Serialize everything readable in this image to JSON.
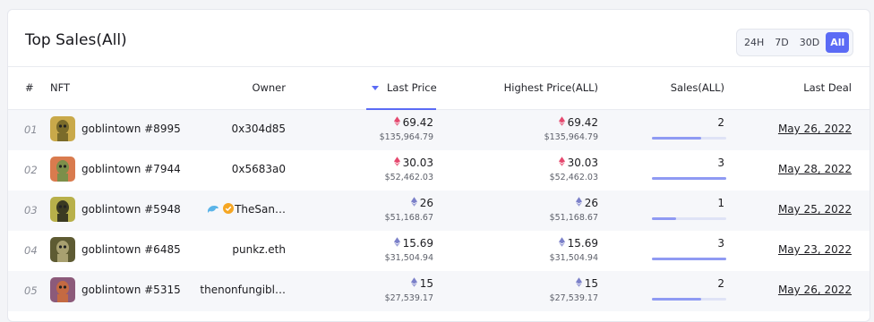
{
  "title": "Top Sales(All)",
  "time_ranges": [
    "24H",
    "7D",
    "30D",
    "All"
  ],
  "active_range": "All",
  "columns": {
    "rank": "#",
    "nft": "NFT",
    "owner": "Owner",
    "last_price": "Last Price",
    "highest_price": "Highest Price(ALL)",
    "sales": "Sales(ALL)",
    "last_deal": "Last Deal"
  },
  "sort_column": "Last Price",
  "colors": {
    "accent": "#5b6bf5",
    "eth_red": "#e5486e",
    "eth_purple": "#7b80c9"
  },
  "rows": [
    {
      "rank": "01",
      "name": "goblintown #8995",
      "owner": "0x304d85",
      "owner_badges": [],
      "last_price": "69.42",
      "last_price_usd": "$135,964.79",
      "last_price_icon": "eth-red-icon",
      "highest_price": "69.42",
      "highest_price_usd": "$135,964.79",
      "highest_price_icon": "eth-red-icon",
      "sales": "2",
      "sales_bar_fraction": 0.66,
      "last_deal": "May 26, 2022"
    },
    {
      "rank": "02",
      "name": "goblintown #7944",
      "owner": "0x5683a0",
      "owner_badges": [],
      "last_price": "30.03",
      "last_price_usd": "$52,462.03",
      "last_price_icon": "eth-red-icon",
      "highest_price": "30.03",
      "highest_price_usd": "$52,462.03",
      "highest_price_icon": "eth-red-icon",
      "sales": "3",
      "sales_bar_fraction": 1.0,
      "last_deal": "May 28, 2022"
    },
    {
      "rank": "03",
      "name": "goblintown #5948",
      "owner": "TheSan…",
      "owner_badges": [
        "dolphin-icon",
        "verified-badge-icon"
      ],
      "last_price": "26",
      "last_price_usd": "$51,168.67",
      "last_price_icon": "eth-purple-icon",
      "highest_price": "26",
      "highest_price_usd": "$51,168.67",
      "highest_price_icon": "eth-purple-icon",
      "sales": "1",
      "sales_bar_fraction": 0.33,
      "last_deal": "May 25, 2022"
    },
    {
      "rank": "04",
      "name": "goblintown #6485",
      "owner": "punkz.eth",
      "owner_badges": [],
      "last_price": "15.69",
      "last_price_usd": "$31,504.94",
      "last_price_icon": "eth-purple-icon",
      "highest_price": "15.69",
      "highest_price_usd": "$31,504.94",
      "highest_price_icon": "eth-purple-icon",
      "sales": "3",
      "sales_bar_fraction": 1.0,
      "last_deal": "May 23, 2022"
    },
    {
      "rank": "05",
      "name": "goblintown #5315",
      "owner": "thenonfungibl…",
      "owner_badges": [],
      "last_price": "15",
      "last_price_usd": "$27,539.17",
      "last_price_icon": "eth-purple-icon",
      "highest_price": "15",
      "highest_price_usd": "$27,539.17",
      "highest_price_icon": "eth-purple-icon",
      "sales": "2",
      "sales_bar_fraction": 0.66,
      "last_deal": "May 26, 2022"
    }
  ]
}
